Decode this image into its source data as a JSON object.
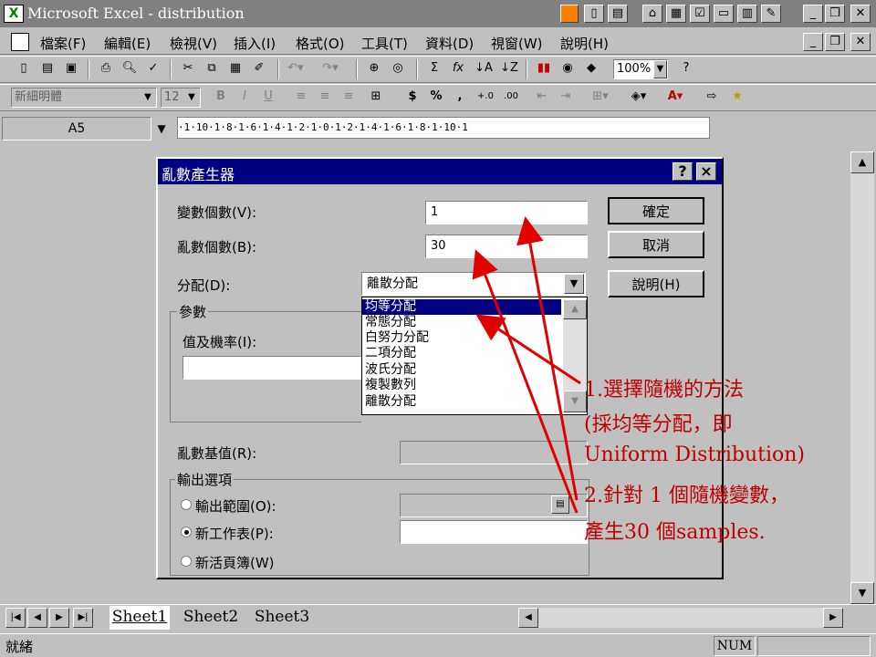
{
  "app": {
    "title": "Microsoft Excel - distribution",
    "logo": "excel-logo-icon"
  },
  "menu": [
    "檔案(F)",
    "編輯(E)",
    "檢視(V)",
    "插入(I)",
    "格式(O)",
    "工具(T)",
    "資料(D)",
    "視窗(W)",
    "說明(H)"
  ],
  "toolbar": {
    "zoom": "100%",
    "sum_symbol": "Σ",
    "fx_symbol": "fx"
  },
  "format_bar": {
    "font": "新細明體",
    "size": "12",
    "bold": "B",
    "italic": "I",
    "underline": "U",
    "currency": "$",
    "percent": "%",
    "comma": ","
  },
  "formula_bar": {
    "name_box": "A5",
    "ruler": "·1·10·1·8·1·6·1·4·1·2·1·0·1·2·1·4·1·6·1·8·1·10·1"
  },
  "dialog": {
    "title": "亂數產生器",
    "help_char": "?",
    "close_char": "×",
    "num_vars_label": "變數個數(V):",
    "num_vars_value": "1",
    "num_rand_label": "亂數個數(B):",
    "num_rand_value": "30",
    "dist_label": "分配(D):",
    "dist_selected": "離散分配",
    "dist_options": [
      "均等分配",
      "常態分配",
      "白努力分配",
      "二項分配",
      "波氏分配",
      "複製數列",
      "離散分配"
    ],
    "params_label": "參數",
    "value_prob_label": "值及機率(I):",
    "seed_label": "亂數基值(R):",
    "output_label": "輸出選項",
    "out_range": "輸出範圍(O):",
    "new_sheet": "新工作表(P):",
    "new_book": "新活頁簿(W)",
    "ok": "確定",
    "cancel": "取消",
    "help": "說明(H)"
  },
  "annotation": {
    "line1": "1.選擇隨機的方法",
    "line2": "(採均等分配，即",
    "line3": "Uniform Distribution)",
    "line4": "2.針對 1 個隨機變數，",
    "line5": "產生30 個samples."
  },
  "sheets": [
    "Sheet1",
    "Sheet2",
    "Sheet3"
  ],
  "status": {
    "ready": "就緒",
    "num": "NUM"
  },
  "colors": {
    "dialog_title_bg": "#000080",
    "annotation": "#c00000",
    "arrow": "#e00000"
  }
}
